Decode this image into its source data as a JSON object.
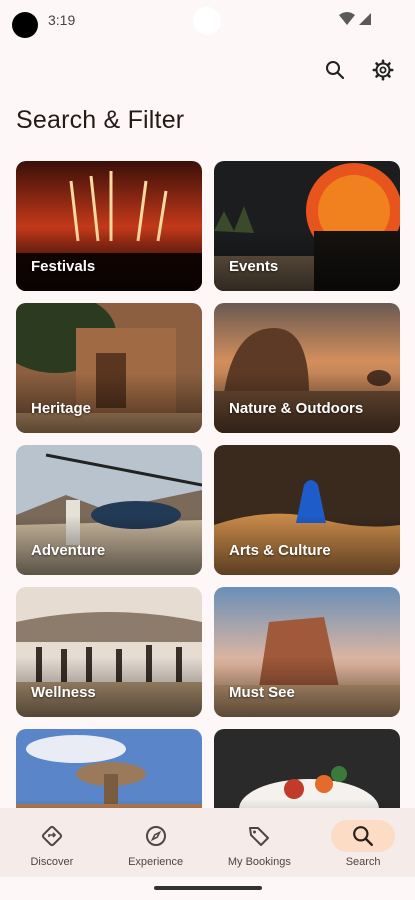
{
  "status_bar": {
    "time": "3:19",
    "icons": [
      "wifi-icon",
      "cell-signal-icon"
    ]
  },
  "header": {
    "title": "Search & Filter",
    "actions": [
      "search-icon",
      "settings-gear-icon"
    ]
  },
  "categories": [
    {
      "label": "Festivals"
    },
    {
      "label": "Events"
    },
    {
      "label": "Heritage"
    },
    {
      "label": "Nature & Outdoors"
    },
    {
      "label": "Adventure"
    },
    {
      "label": "Arts & Culture"
    },
    {
      "label": "Wellness"
    },
    {
      "label": "Must See"
    },
    {
      "label": ""
    },
    {
      "label": ""
    }
  ],
  "bottom_nav": {
    "active": "Search",
    "accent_color": "#fddcc6",
    "items": [
      {
        "label": "Discover",
        "icon": "compass-diamond-icon"
      },
      {
        "label": "Experience",
        "icon": "compass-icon"
      },
      {
        "label": "My Bookings",
        "icon": "tag-icon"
      },
      {
        "label": "Search",
        "icon": "search-icon"
      }
    ]
  }
}
